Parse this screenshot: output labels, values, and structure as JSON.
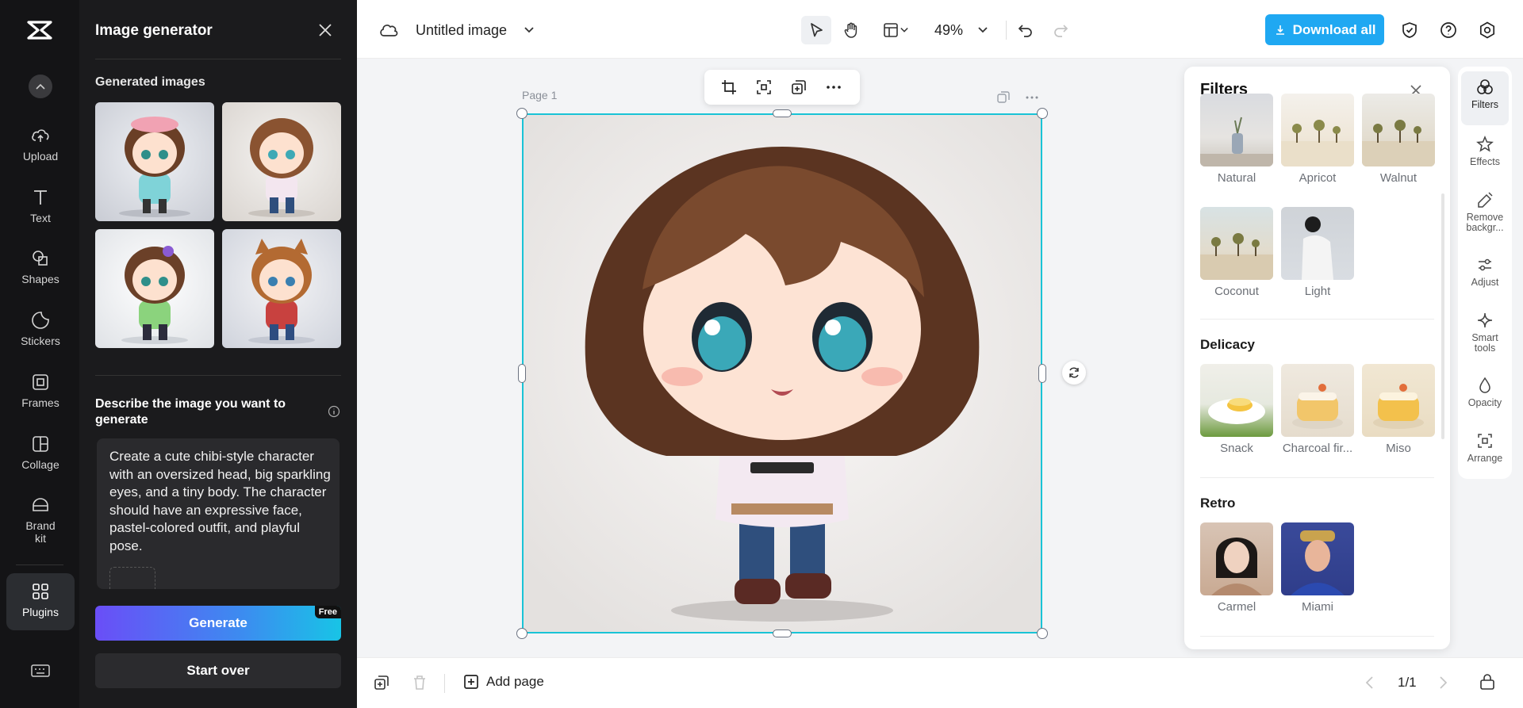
{
  "rail": {
    "items": [
      {
        "label": "Upload",
        "icon": "upload-icon"
      },
      {
        "label": "Text",
        "icon": "text-icon"
      },
      {
        "label": "Shapes",
        "icon": "shapes-icon"
      },
      {
        "label": "Stickers",
        "icon": "stickers-icon"
      },
      {
        "label": "Frames",
        "icon": "frames-icon"
      },
      {
        "label": "Collage",
        "icon": "collage-icon"
      },
      {
        "label": "Brand kit",
        "icon": "brand-kit-icon"
      },
      {
        "label": "Plugins",
        "icon": "plugins-icon"
      }
    ]
  },
  "generator": {
    "title": "Image generator",
    "generated_heading": "Generated images",
    "describe_label": "Describe the image you want to generate",
    "prompt": "Create a cute chibi-style character with an oversized head, big sparkling eyes, and a tiny body. The character should have an expressive face, pastel-colored outfit, and playful pose.",
    "generate_label": "Generate",
    "free_badge": "Free",
    "start_over_label": "Start over"
  },
  "topbar": {
    "title": "Untitled image",
    "zoom": "49%",
    "download_label": "Download all"
  },
  "canvas": {
    "page_label": "Page 1"
  },
  "filters": {
    "title": "Filters",
    "top_items": [
      "Natural",
      "Apricot",
      "Walnut",
      "Coconut",
      "Light"
    ],
    "sections": [
      {
        "name": "Delicacy",
        "items": [
          "Snack",
          "Charcoal fir...",
          "Miso"
        ]
      },
      {
        "name": "Retro",
        "items": [
          "Carmel",
          "Miami"
        ]
      }
    ]
  },
  "right_rail": {
    "items": [
      "Filters",
      "Effects",
      "Remove backgr...",
      "Adjust",
      "Smart tools",
      "Opacity",
      "Arrange"
    ]
  },
  "bottombar": {
    "add_page_label": "Add page",
    "pager": "1/1"
  },
  "colors": {
    "accent": "#1fa8f2",
    "selection": "#19c3d6",
    "dark_panel": "#1b1b1d"
  }
}
